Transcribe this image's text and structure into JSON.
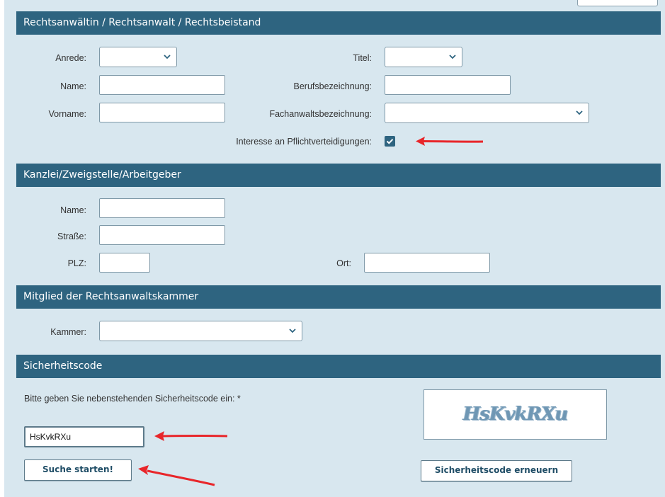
{
  "sections": {
    "lawyer": "Rechtsanwältin / Rechtsanwalt / Rechtsbeistand",
    "office": "Kanzlei/Zweigstelle/Arbeitgeber",
    "chamber": "Mitglied der Rechtsanwaltskammer",
    "security": "Sicherheitscode"
  },
  "lawyer": {
    "salutation_label": "Anrede:",
    "salutation_value": "",
    "title_label": "Titel:",
    "title_value": "",
    "name_label": "Name:",
    "name_value": "",
    "profession_label": "Berufsbezeichnung:",
    "profession_value": "",
    "firstname_label": "Vorname:",
    "firstname_value": "",
    "specialist_label": "Fachanwaltsbezeichnung:",
    "specialist_value": "",
    "interest_label": "Interesse an Pflichtverteidigungen:",
    "interest_checked": true
  },
  "office": {
    "name_label": "Name:",
    "name_value": "",
    "street_label": "Straße:",
    "street_value": "",
    "zip_label": "PLZ:",
    "zip_value": "",
    "city_label": "Ort:",
    "city_value": ""
  },
  "chamber": {
    "label": "Kammer:",
    "value": ""
  },
  "security": {
    "prompt": "Bitte geben Sie nebenstehenden Sicherheitscode ein: *",
    "input_value": "HsKvkRXu",
    "captcha_text": "HsKvkRXu",
    "renew_button": "Sicherheitscode erneuern"
  },
  "search_button": "Suche starten!",
  "colors": {
    "header_bg": "#2e6480",
    "panel_bg": "#d8e7ef",
    "annotation_arrow": "#e8262a"
  }
}
